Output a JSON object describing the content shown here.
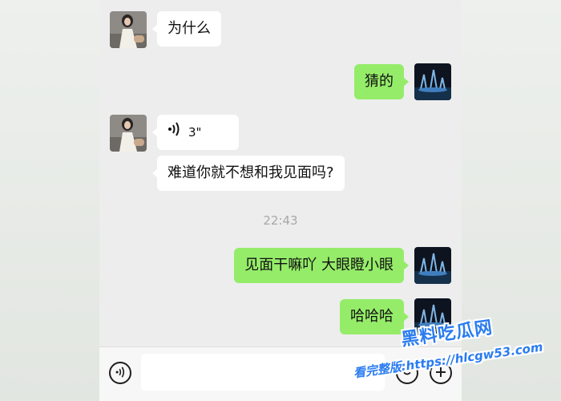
{
  "messages": {
    "m1": "为什么",
    "m2": "猜的",
    "voice_duration": "3\"",
    "m4": "难道你就不想和我见面吗?",
    "timestamp": "22:43",
    "m5": "见面干嘛吖 大眼瞪小眼",
    "m6": "哈哈哈"
  },
  "input": {
    "value": "",
    "placeholder": ""
  },
  "icons": {
    "voice_input": "voice-mode-icon",
    "emoji": "emoji-icon",
    "more": "plus-icon",
    "voice_message": "sound-wave-icon"
  },
  "colors": {
    "outgoing_bubble": "#95ec69",
    "incoming_bubble": "#ffffff",
    "chat_background": "#ededed",
    "watermark": "#2a7cf0"
  },
  "watermark": {
    "brand": "黑料吃瓜网",
    "url": "看完整版:https://hlcgw53.com"
  }
}
